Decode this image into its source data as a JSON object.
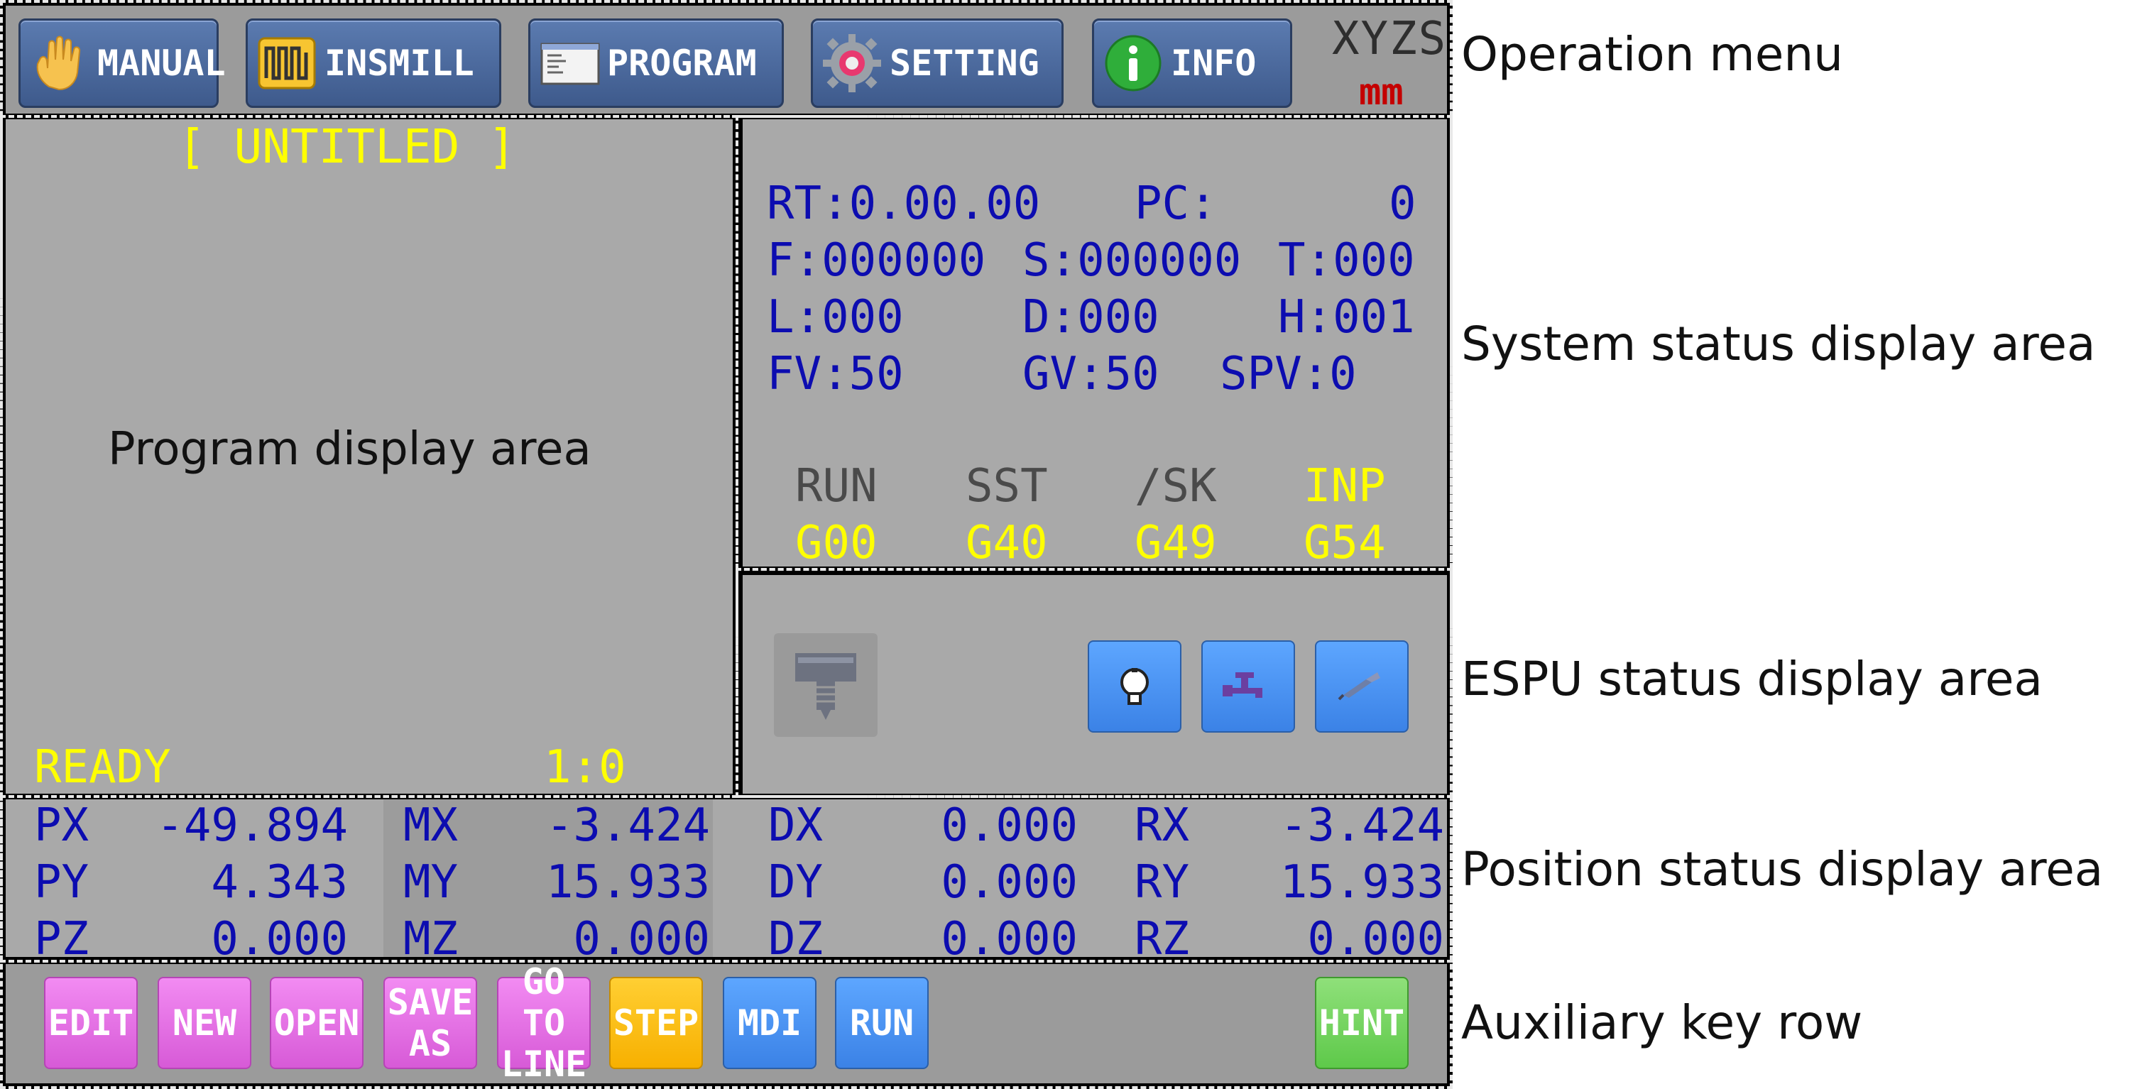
{
  "menu": {
    "items": [
      {
        "label": "MANUAL",
        "icon": "hand-icon"
      },
      {
        "label": "INSMILL",
        "icon": "pulse-chart-icon"
      },
      {
        "label": "PROGRAM",
        "icon": "document-icon"
      },
      {
        "label": "SETTING",
        "icon": "gear-icon"
      },
      {
        "label": "INFO",
        "icon": "info-icon"
      }
    ],
    "axes": "XYZS",
    "unit": "mm"
  },
  "program": {
    "title": "[ UNTITLED ]",
    "placeholder": "Program display area",
    "state": "READY",
    "position": "1:0"
  },
  "system_status": {
    "row1": {
      "rt": "RT:0.00.00",
      "pc_label": "PC:",
      "pc_value": "0"
    },
    "row2": {
      "f": "F:000000",
      "s": "S:000000",
      "t": "T:000"
    },
    "row3": {
      "l": "L:000",
      "d": "D:000",
      "h": "H:001"
    },
    "row4": {
      "fv": "FV:50",
      "gv": "GV:50",
      "spv": "SPV:0"
    },
    "flags": [
      "RUN",
      "SST",
      "/SK",
      "INP"
    ],
    "gcodes": [
      "G00",
      "G40",
      "G49",
      "G54"
    ]
  },
  "espu": {
    "icons": [
      "spindle-icon",
      "light-bulb-icon",
      "coolant-tap-icon",
      "air-blow-icon"
    ]
  },
  "position": {
    "rows": [
      {
        "p_label": "PX",
        "p": "-49.894",
        "m_label": "MX",
        "m": "-3.424",
        "d_label": "DX",
        "d": "0.000",
        "r_label": "RX",
        "r": "-3.424"
      },
      {
        "p_label": "PY",
        "p": "4.343",
        "m_label": "MY",
        "m": "15.933",
        "d_label": "DY",
        "d": "0.000",
        "r_label": "RY",
        "r": "15.933"
      },
      {
        "p_label": "PZ",
        "p": "0.000",
        "m_label": "MZ",
        "m": "0.000",
        "d_label": "DZ",
        "d": "0.000",
        "r_label": "RZ",
        "r": "0.000"
      }
    ]
  },
  "aux_keys": {
    "edit": "EDIT",
    "new": "NEW",
    "open": "OPEN",
    "save_as_1": "SAVE",
    "save_as_2": "AS",
    "goto_1": "GO TO",
    "goto_2": "LINE",
    "step": "STEP",
    "mdi": "MDI",
    "run": "RUN",
    "hint": "HINT"
  },
  "callouts": {
    "operation_menu": "Operation menu",
    "system_status": "System status display area",
    "espu_status": "ESPU status display area",
    "position_status": "Position status display area",
    "aux_row": "Auxiliary key row"
  },
  "colors": {
    "panel": "#a9a9a9",
    "status_text": "#0c0cb0",
    "highlight": "#ffff00",
    "unit": "#c40000"
  }
}
